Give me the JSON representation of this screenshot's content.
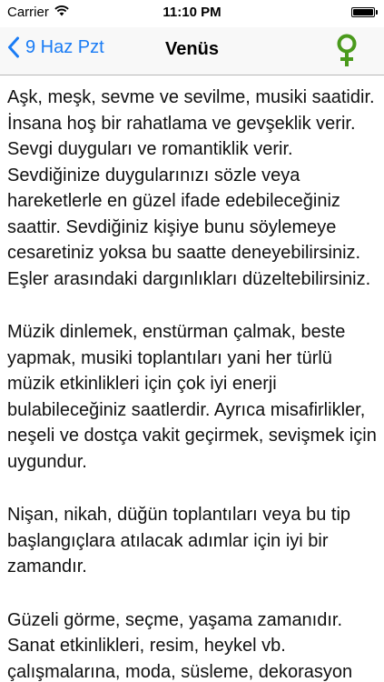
{
  "status_bar": {
    "carrier": "Carrier",
    "time": "11:10 PM",
    "wifi_icon": "wifi-icon",
    "battery_icon": "battery-icon"
  },
  "nav": {
    "back_label": "9 Haz Pzt",
    "title": "Venüs",
    "planet_icon": "venus-symbol-icon",
    "accent_color": "#1a7cf5",
    "icon_color": "#4a9a1c"
  },
  "content": {
    "paragraphs": [
      "Aşk, meşk, sevme ve sevilme, musiki saatidir. İnsana hoş bir rahatlama ve gevşeklik verir. Sevgi duyguları ve romantiklik verir. Sevdiğinize duygularınızı sözle veya hareketlerle en güzel ifade edebileceğiniz saattir. Sevdiğiniz kişiye bunu söylemeye cesaretiniz yoksa bu saatte deneyebilirsiniz. Eşler arasındaki dargınlıkları düzeltebilirsiniz.",
      "Müzik dinlemek, enstürman çalmak, beste yapmak, musiki toplantıları yani her türlü müzik etkinlikleri için çok iyi enerji bulabileceğiniz saatlerdir. Ayrıca misafirlikler, neşeli ve dostça vakit geçirmek, sevişmek için uygundur.",
      "Nişan, nikah, düğün toplantıları veya bu tip başlangıçlara atılacak adımlar için iyi bir zamandır.",
      "Güzeli görme, seçme, yaşama zamanıdır. Sanat etkinlikleri, resim, heykel vb. çalışmalarına, moda, süsleme, dekorasyon"
    ]
  }
}
